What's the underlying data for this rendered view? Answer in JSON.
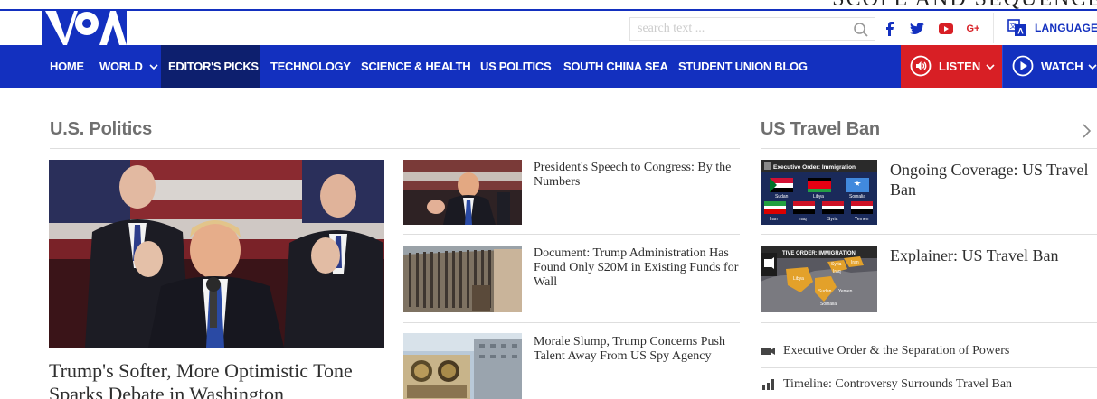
{
  "overlay_text": "SCOPE AND SEQUENCE",
  "brand": {
    "logo": "VOA",
    "color": "#1330bf"
  },
  "search": {
    "placeholder": "search text ...",
    "icon": "search-icon"
  },
  "social": [
    {
      "name": "facebook",
      "glyph": "f",
      "color": "#3b5998"
    },
    {
      "name": "twitter",
      "glyph": "t",
      "color": "#1da1f2"
    },
    {
      "name": "youtube",
      "glyph": "▶",
      "color": "#e62117"
    },
    {
      "name": "google-plus",
      "glyph": "G+",
      "color": "#dd4b39"
    }
  ],
  "languages_label": "LANGUAGES",
  "nav": {
    "items": [
      {
        "label": "HOME"
      },
      {
        "label": "WORLD",
        "dropdown": true
      },
      {
        "label": "EDITOR'S PICKS",
        "active": true
      },
      {
        "label": "TECHNOLOGY"
      },
      {
        "label": "SCIENCE & HEALTH"
      },
      {
        "label": "US POLITICS"
      },
      {
        "label": "SOUTH CHINA SEA"
      },
      {
        "label": "STUDENT UNION BLOG"
      }
    ],
    "listen_label": "LISTEN",
    "watch_label": "WATCH",
    "listen_color": "#d81f25"
  },
  "us_politics": {
    "title": "U.S. Politics",
    "lead_headline": "Trump's Softer, More Optimistic Tone Sparks Debate in Washington",
    "side_stories": [
      {
        "headline": "President's Speech to Congress: By the Numbers"
      },
      {
        "headline": "Document: Trump Administration Has Found Only $20M in Existing Funds for Wall"
      },
      {
        "headline": "Morale Slump, Trump Concerns Push Talent Away From US Spy Agency"
      }
    ]
  },
  "travel_ban": {
    "title": "US Travel Ban",
    "stories": [
      {
        "headline": "Ongoing Coverage: US Travel Ban",
        "thumb_caption": "Executive Order: Immigration",
        "thumb_countries": [
          "Sudan",
          "Libya",
          "Somalia",
          "Iran",
          "Iraq",
          "Syria",
          "Yemen"
        ]
      },
      {
        "headline": "Explainer: US Travel Ban",
        "thumb_caption": "TIVE ORDER: IMMIGRATION",
        "thumb_countries": [
          "Syria",
          "Iraq",
          "Iran",
          "Libya",
          "Sudan",
          "Yemen",
          "Somalia"
        ]
      }
    ],
    "links": [
      {
        "label": "Executive Order & the Separation of Powers",
        "icon": "video-icon"
      },
      {
        "label": "Timeline: Controversy Surrounds Travel Ban",
        "icon": "bar-chart-icon"
      }
    ]
  }
}
